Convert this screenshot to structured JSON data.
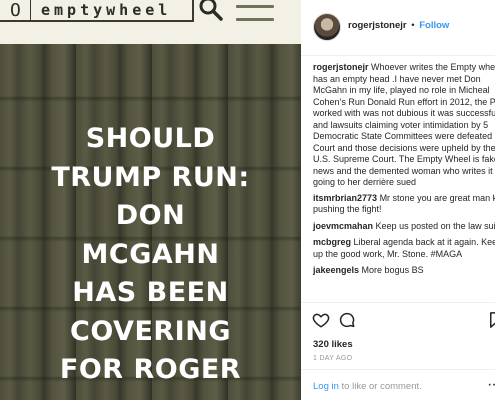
{
  "site": {
    "logo_letter": "O",
    "logo_text": "emptywheel",
    "search_icon": "search-icon",
    "menu_icon": "hamburger-menu-icon"
  },
  "headline": {
    "lines": [
      "SHOULD",
      "TRUMP RUN:",
      "DON",
      "MCGAHN",
      "HAS BEEN",
      "COVERING",
      "FOR ROGER"
    ]
  },
  "instagram": {
    "username": "rogerjstonejr",
    "separator": "•",
    "follow_label": "Follow",
    "caption_user": "rogerjstonejr",
    "caption_text": "Whoever writes the Empty wheel has an empty head .I have never met Don McGahn in my life, played no role in Micheal Cohen’s Run Donald Run effort in 2012, the PAC I worked with was not dubious it was successful and lawsuits claiming voter intimidation by 5 Democratic State Committees were defeated in Court and those decisions were upheld by the U.S. Supreme Court. The Empty Wheel is fake news and the demented woman who writes it is going to her derrière sued",
    "comments": [
      {
        "user": "itsmrbrian2773",
        "text": "Mr stone you are great man keep pushing the fight!"
      },
      {
        "user": "joevmcmahan",
        "text": "Keep us posted on the law suit."
      },
      {
        "user": "mcbgreg",
        "text": "Liberal agenda back at it again. Keep up the good work, Mr. Stone. #MAGA"
      },
      {
        "user": "jakeengels",
        "text": "More bogus BS"
      }
    ],
    "likes": "320 likes",
    "time_ago": "1 DAY AGO",
    "login_link": "Log in",
    "login_rest": "to like or comment.",
    "more_icon": "more-options-icon",
    "colors": {
      "link": "#3897f0",
      "text": "#262626",
      "muted": "#999999"
    }
  }
}
